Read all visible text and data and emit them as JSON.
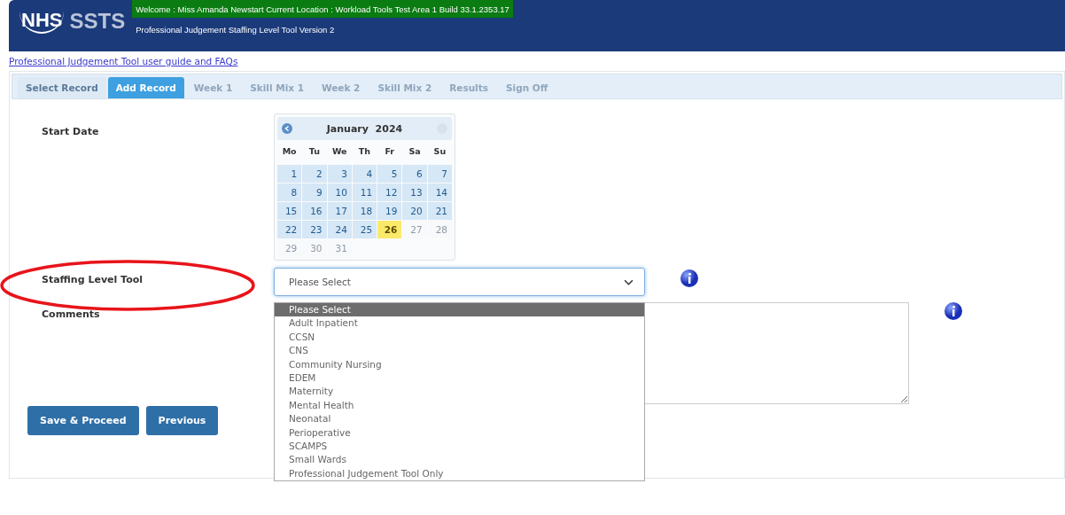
{
  "header": {
    "logo_mark": "NHS",
    "logo_text": "SSTS",
    "welcome": "Welcome : Miss Amanda Newstart Current Location : Workload Tools Test Area 1 Build 33.1.2353.17",
    "subtitle": "Professional Judgement Staffing Level Tool Version 2"
  },
  "guide_link": "Professional Judgement Tool user guide and FAQs",
  "tabs": [
    {
      "label": "Select Record",
      "selected": false,
      "disabled": false
    },
    {
      "label": "Add Record",
      "selected": true,
      "disabled": false
    },
    {
      "label": "Week 1",
      "selected": false,
      "disabled": true
    },
    {
      "label": "Skill Mix 1",
      "selected": false,
      "disabled": true
    },
    {
      "label": "Week 2",
      "selected": false,
      "disabled": true
    },
    {
      "label": "Skill Mix 2",
      "selected": false,
      "disabled": true
    },
    {
      "label": "Results",
      "selected": false,
      "disabled": true
    },
    {
      "label": "Sign Off",
      "selected": false,
      "disabled": true
    }
  ],
  "form": {
    "start_date_label": "Start Date",
    "calendar": {
      "month": "January",
      "year": "2024",
      "weekdays": [
        "Mo",
        "Tu",
        "We",
        "Th",
        "Fr",
        "Sa",
        "Su"
      ],
      "days": [
        {
          "label": "1",
          "disabled": false,
          "selected": false
        },
        {
          "label": "2",
          "disabled": false,
          "selected": false
        },
        {
          "label": "3",
          "disabled": false,
          "selected": false
        },
        {
          "label": "4",
          "disabled": false,
          "selected": false
        },
        {
          "label": "5",
          "disabled": false,
          "selected": false
        },
        {
          "label": "6",
          "disabled": false,
          "selected": false
        },
        {
          "label": "7",
          "disabled": false,
          "selected": false
        },
        {
          "label": "8",
          "disabled": false,
          "selected": false
        },
        {
          "label": "9",
          "disabled": false,
          "selected": false
        },
        {
          "label": "10",
          "disabled": false,
          "selected": false
        },
        {
          "label": "11",
          "disabled": false,
          "selected": false
        },
        {
          "label": "12",
          "disabled": false,
          "selected": false
        },
        {
          "label": "13",
          "disabled": false,
          "selected": false
        },
        {
          "label": "14",
          "disabled": false,
          "selected": false
        },
        {
          "label": "15",
          "disabled": false,
          "selected": false
        },
        {
          "label": "16",
          "disabled": false,
          "selected": false
        },
        {
          "label": "17",
          "disabled": false,
          "selected": false
        },
        {
          "label": "18",
          "disabled": false,
          "selected": false
        },
        {
          "label": "19",
          "disabled": false,
          "selected": false
        },
        {
          "label": "20",
          "disabled": false,
          "selected": false
        },
        {
          "label": "21",
          "disabled": false,
          "selected": false
        },
        {
          "label": "22",
          "disabled": false,
          "selected": false
        },
        {
          "label": "23",
          "disabled": false,
          "selected": false
        },
        {
          "label": "24",
          "disabled": false,
          "selected": false
        },
        {
          "label": "25",
          "disabled": false,
          "selected": false
        },
        {
          "label": "26",
          "disabled": false,
          "selected": true
        },
        {
          "label": "27",
          "disabled": true,
          "selected": false
        },
        {
          "label": "28",
          "disabled": true,
          "selected": false
        },
        {
          "label": "29",
          "disabled": true,
          "selected": false
        },
        {
          "label": "30",
          "disabled": true,
          "selected": false
        },
        {
          "label": "31",
          "disabled": true,
          "selected": false
        }
      ]
    },
    "staffing_label": "Staffing Level Tool",
    "staffing_select": {
      "value": "Please Select",
      "expanded": true,
      "options": [
        {
          "label": "Please Select",
          "selected": true
        },
        {
          "label": "Adult Inpatient",
          "selected": false
        },
        {
          "label": "CCSN",
          "selected": false
        },
        {
          "label": "CNS",
          "selected": false
        },
        {
          "label": "Community Nursing",
          "selected": false
        },
        {
          "label": "EDEM",
          "selected": false
        },
        {
          "label": "Maternity",
          "selected": false
        },
        {
          "label": "Mental Health",
          "selected": false
        },
        {
          "label": "Neonatal",
          "selected": false
        },
        {
          "label": "Perioperative",
          "selected": false
        },
        {
          "label": "SCAMPS",
          "selected": false
        },
        {
          "label": "Small Wards",
          "selected": false
        },
        {
          "label": "Professional Judgement Tool Only",
          "selected": false
        }
      ]
    },
    "comments_label": "Comments",
    "buttons": [
      "Save & Proceed",
      "Previous"
    ]
  }
}
